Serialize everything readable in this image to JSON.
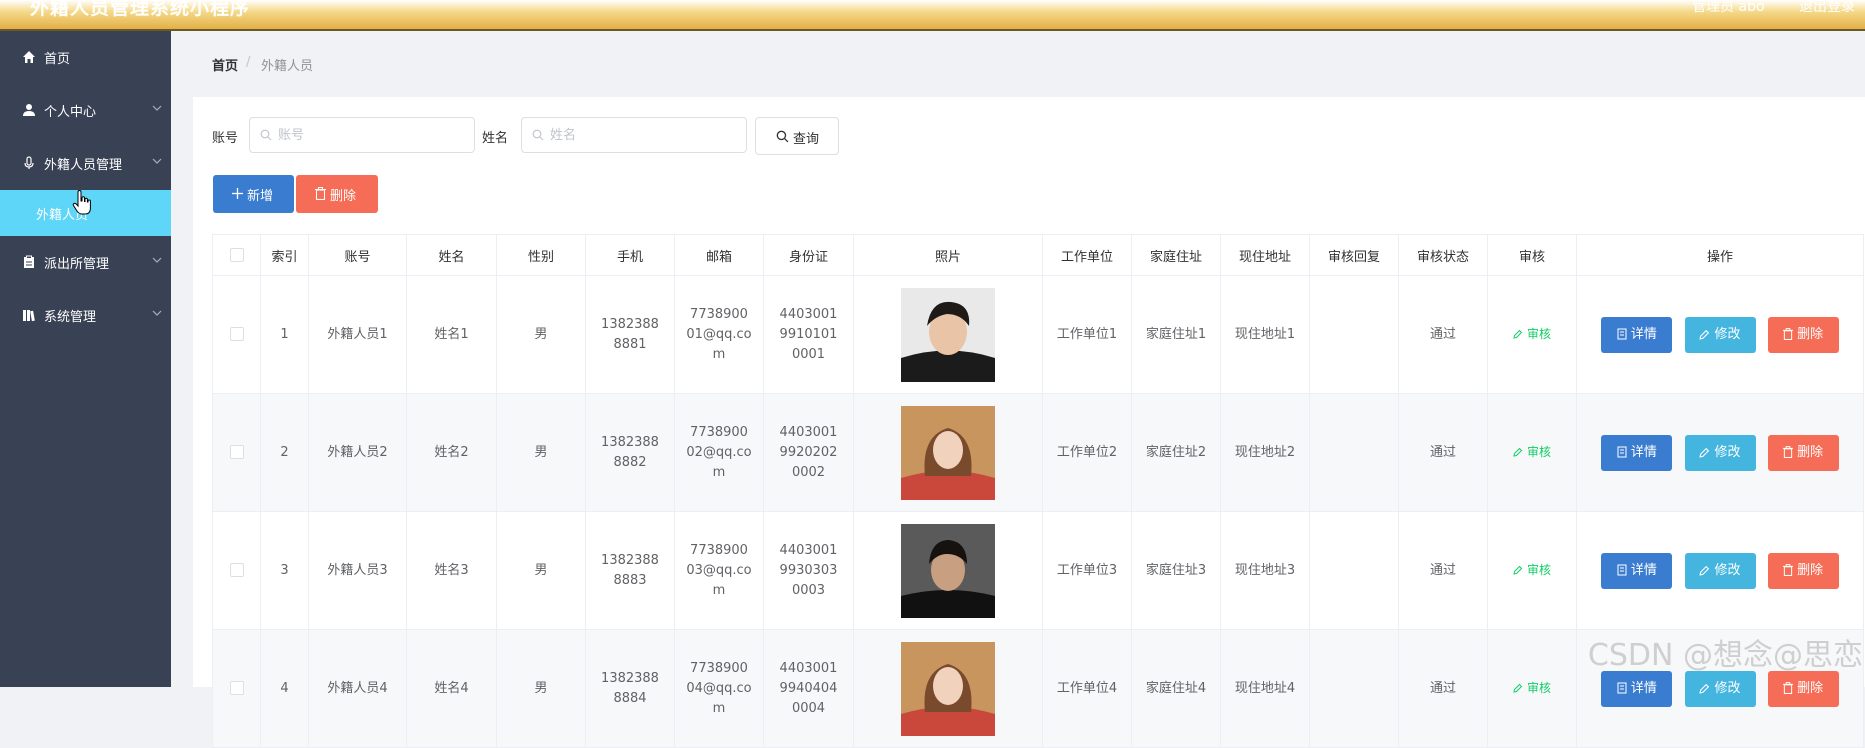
{
  "app": {
    "title": "外籍人员管理系统小程序",
    "user_label": "管理员 abo",
    "logout_label": "退出登录",
    "accent_color": "#5ed6f7",
    "sidebar_color": "#394155"
  },
  "sidebar": {
    "items": [
      {
        "label": "首页",
        "icon": "home-icon",
        "has_children": false
      },
      {
        "label": "个人中心",
        "icon": "user-icon",
        "has_children": true
      },
      {
        "label": "外籍人员管理",
        "icon": "microphone-icon",
        "has_children": true
      },
      {
        "label": "外籍人员",
        "icon": "",
        "has_children": false,
        "active": true
      },
      {
        "label": "派出所管理",
        "icon": "clipboard-icon",
        "has_children": true
      },
      {
        "label": "系统管理",
        "icon": "books-icon",
        "has_children": true
      }
    ]
  },
  "breadcrumb": {
    "home": "首页",
    "separator": "/",
    "current": "外籍人员"
  },
  "search": {
    "account_label": "账号",
    "account_placeholder": "账号",
    "name_label": "姓名",
    "name_placeholder": "姓名",
    "query_label": "查询"
  },
  "actions": {
    "add_label": "新增",
    "delete_label": "删除"
  },
  "table": {
    "columns": [
      "索引",
      "账号",
      "姓名",
      "性别",
      "手机",
      "邮箱",
      "身份证",
      "照片",
      "工作单位",
      "家庭住址",
      "现住地址",
      "审核回复",
      "审核状态",
      "审核",
      "操作"
    ],
    "audit_link": "审核",
    "detail_btn": "详情",
    "edit_btn": "修改",
    "delete_btn": "删除",
    "rows": [
      {
        "index": "1",
        "account": "外籍人员1",
        "name": "姓名1",
        "gender": "男",
        "phone": "13823888881",
        "email": "773890001@qq.com",
        "id_card": "440300199101010001",
        "work_unit": "工作单位1",
        "home_addr": "家庭住址1",
        "current_addr": "现住地址1",
        "audit_reply": "",
        "audit_status": "通过",
        "photo": "young-man-black-shirt"
      },
      {
        "index": "2",
        "account": "外籍人员2",
        "name": "姓名2",
        "gender": "男",
        "phone": "13823888882",
        "email": "773890002@qq.com",
        "id_card": "440300199202020002",
        "work_unit": "工作单位2",
        "home_addr": "家庭住址2",
        "current_addr": "现住地址2",
        "audit_reply": "",
        "audit_status": "通过",
        "photo": "young-woman-red-top"
      },
      {
        "index": "3",
        "account": "外籍人员3",
        "name": "姓名3",
        "gender": "男",
        "phone": "13823888883",
        "email": "773890003@qq.com",
        "id_card": "440300199303030003",
        "work_unit": "工作单位3",
        "home_addr": "家庭住址3",
        "current_addr": "现住地址3",
        "audit_reply": "",
        "audit_status": "通过",
        "photo": "young-man-dark"
      },
      {
        "index": "4",
        "account": "外籍人员4",
        "name": "姓名4",
        "gender": "男",
        "phone": "13823888884",
        "email": "773890004@qq.com",
        "id_card": "440300199404040004",
        "work_unit": "工作单位4",
        "home_addr": "家庭住址4",
        "current_addr": "现住地址4",
        "audit_reply": "",
        "audit_status": "通过",
        "photo": "young-woman-red-top"
      }
    ]
  },
  "watermark": "CSDN @想念@思恋"
}
